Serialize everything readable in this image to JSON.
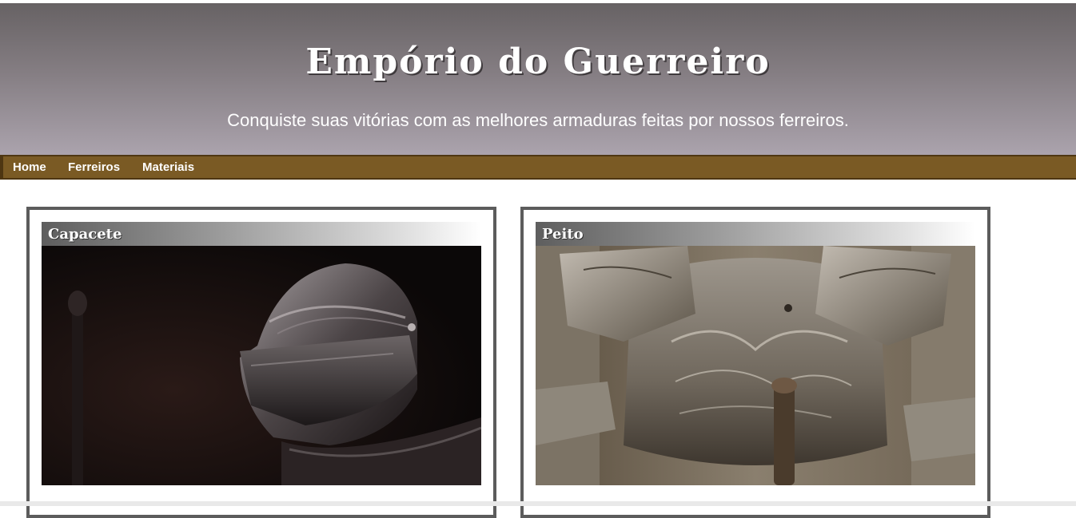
{
  "header": {
    "title": "Empório do Guerreiro",
    "subtitle": "Conquiste suas vitórias com as melhores armaduras feitas por nossos ferreiros."
  },
  "nav": {
    "items": [
      {
        "label": "Home"
      },
      {
        "label": "Ferreiros"
      },
      {
        "label": "Materiais"
      }
    ]
  },
  "cards": [
    {
      "title": "Capacete",
      "image_icon": "knight-helmet-photo"
    },
    {
      "title": "Peito",
      "image_icon": "engraved-breastplate-photo"
    }
  ],
  "colors": {
    "header_top": "#676264",
    "header_bottom": "#aba3ad",
    "nav_bg": "#7a5a24",
    "card_border": "#5c5c5c"
  }
}
